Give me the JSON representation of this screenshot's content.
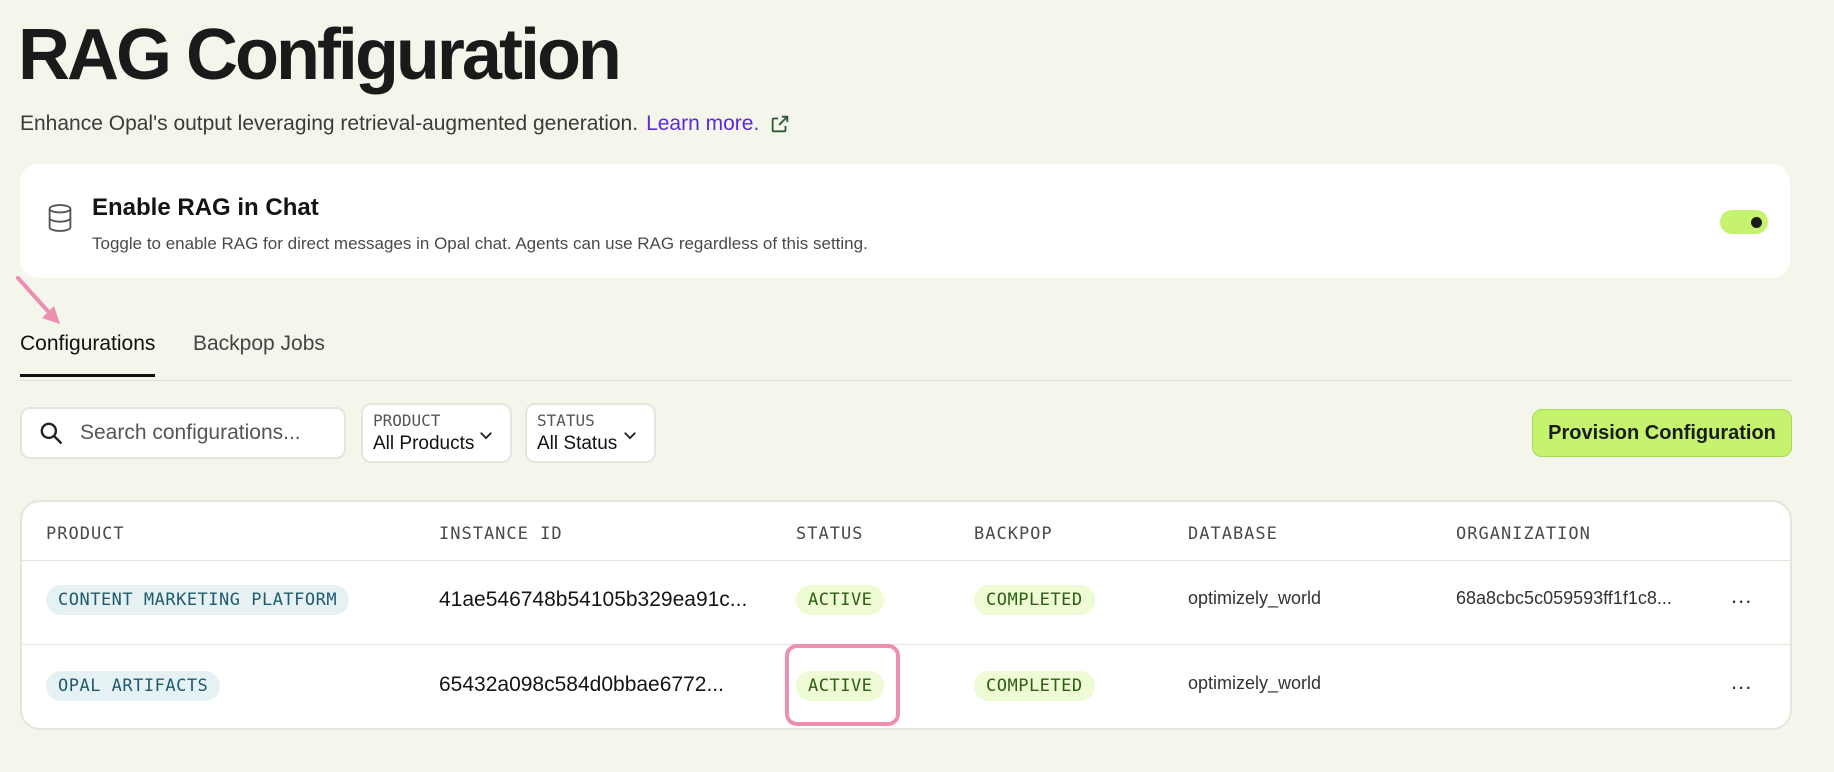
{
  "header": {
    "title": "RAG Configuration",
    "subtitle": "Enhance Opal's output leveraging retrieval-augmented generation.",
    "learn_more": "Learn more."
  },
  "rag_toggle": {
    "title": "Enable RAG in Chat",
    "description": "Toggle to enable RAG for direct messages in Opal chat. Agents can use RAG regardless of this setting.",
    "enabled": true
  },
  "tabs": [
    {
      "label": "Configurations",
      "active": true
    },
    {
      "label": "Backpop Jobs",
      "active": false
    }
  ],
  "toolbar": {
    "search_placeholder": "Search configurations...",
    "product_filter": {
      "label": "PRODUCT",
      "value": "All Products"
    },
    "status_filter": {
      "label": "STATUS",
      "value": "All Status"
    },
    "provision_label": "Provision Configuration"
  },
  "table": {
    "columns": [
      "PRODUCT",
      "INSTANCE ID",
      "STATUS",
      "BACKPOP",
      "DATABASE",
      "ORGANIZATION"
    ],
    "rows": [
      {
        "product": "CONTENT MARKETING PLATFORM",
        "instance_id": "41ae546748b54105b329ea91c...",
        "status": "ACTIVE",
        "backpop": "COMPLETED",
        "database": "optimizely_world",
        "organization": "68a8cbc5c059593ff1f1c8...",
        "more": "..."
      },
      {
        "product": "OPAL ARTIFACTS",
        "instance_id": "65432a098c584d0bbae6772...",
        "status": "ACTIVE",
        "backpop": "COMPLETED",
        "database": "optimizely_world",
        "organization": "",
        "more": "..."
      }
    ]
  },
  "colors": {
    "background": "#f4f6ec",
    "accent": "#c6f36e",
    "link": "#5b2ad6",
    "annotation": "#ec8fb1"
  }
}
